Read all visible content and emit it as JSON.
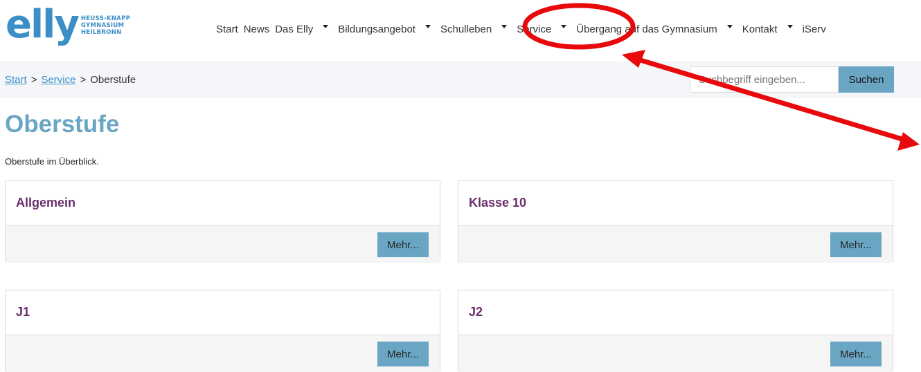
{
  "header": {
    "logo_word": "elly",
    "logo_lines": [
      "HEUSS-KNAPP",
      "GYMNASIUM",
      "HEILBRONN"
    ],
    "nav": [
      {
        "label": "Start",
        "dropdown": false
      },
      {
        "label": "News",
        "dropdown": false
      },
      {
        "label": "Das Elly",
        "dropdown": true
      },
      {
        "label": "Bildungsangebot",
        "dropdown": true
      },
      {
        "label": "Schulleben",
        "dropdown": true
      },
      {
        "label": "Service",
        "dropdown": true
      },
      {
        "label": "Übergang auf das Gymnasium",
        "dropdown": true
      },
      {
        "label": "Kontakt",
        "dropdown": true
      },
      {
        "label": "iServ",
        "dropdown": false
      }
    ]
  },
  "breadcrumb": {
    "items": [
      "Start",
      "Service"
    ],
    "current": "Oberstufe",
    "separator": ">"
  },
  "search": {
    "placeholder": "Suchbegriff eingeben...",
    "button": "Suchen"
  },
  "main": {
    "title": "Oberstufe",
    "intro": "Oberstufe im Überblick.",
    "cards": [
      {
        "title": "Allgemein",
        "button": "Mehr..."
      },
      {
        "title": "Klasse 10",
        "button": "Mehr..."
      },
      {
        "title": "J1",
        "button": "Mehr..."
      },
      {
        "title": "J2",
        "button": "Mehr..."
      }
    ]
  },
  "colors": {
    "brand": "#3b8fc6",
    "accent": "#6aa6c4",
    "card_title": "#6a2f6d",
    "annotation": "#e8090c"
  }
}
